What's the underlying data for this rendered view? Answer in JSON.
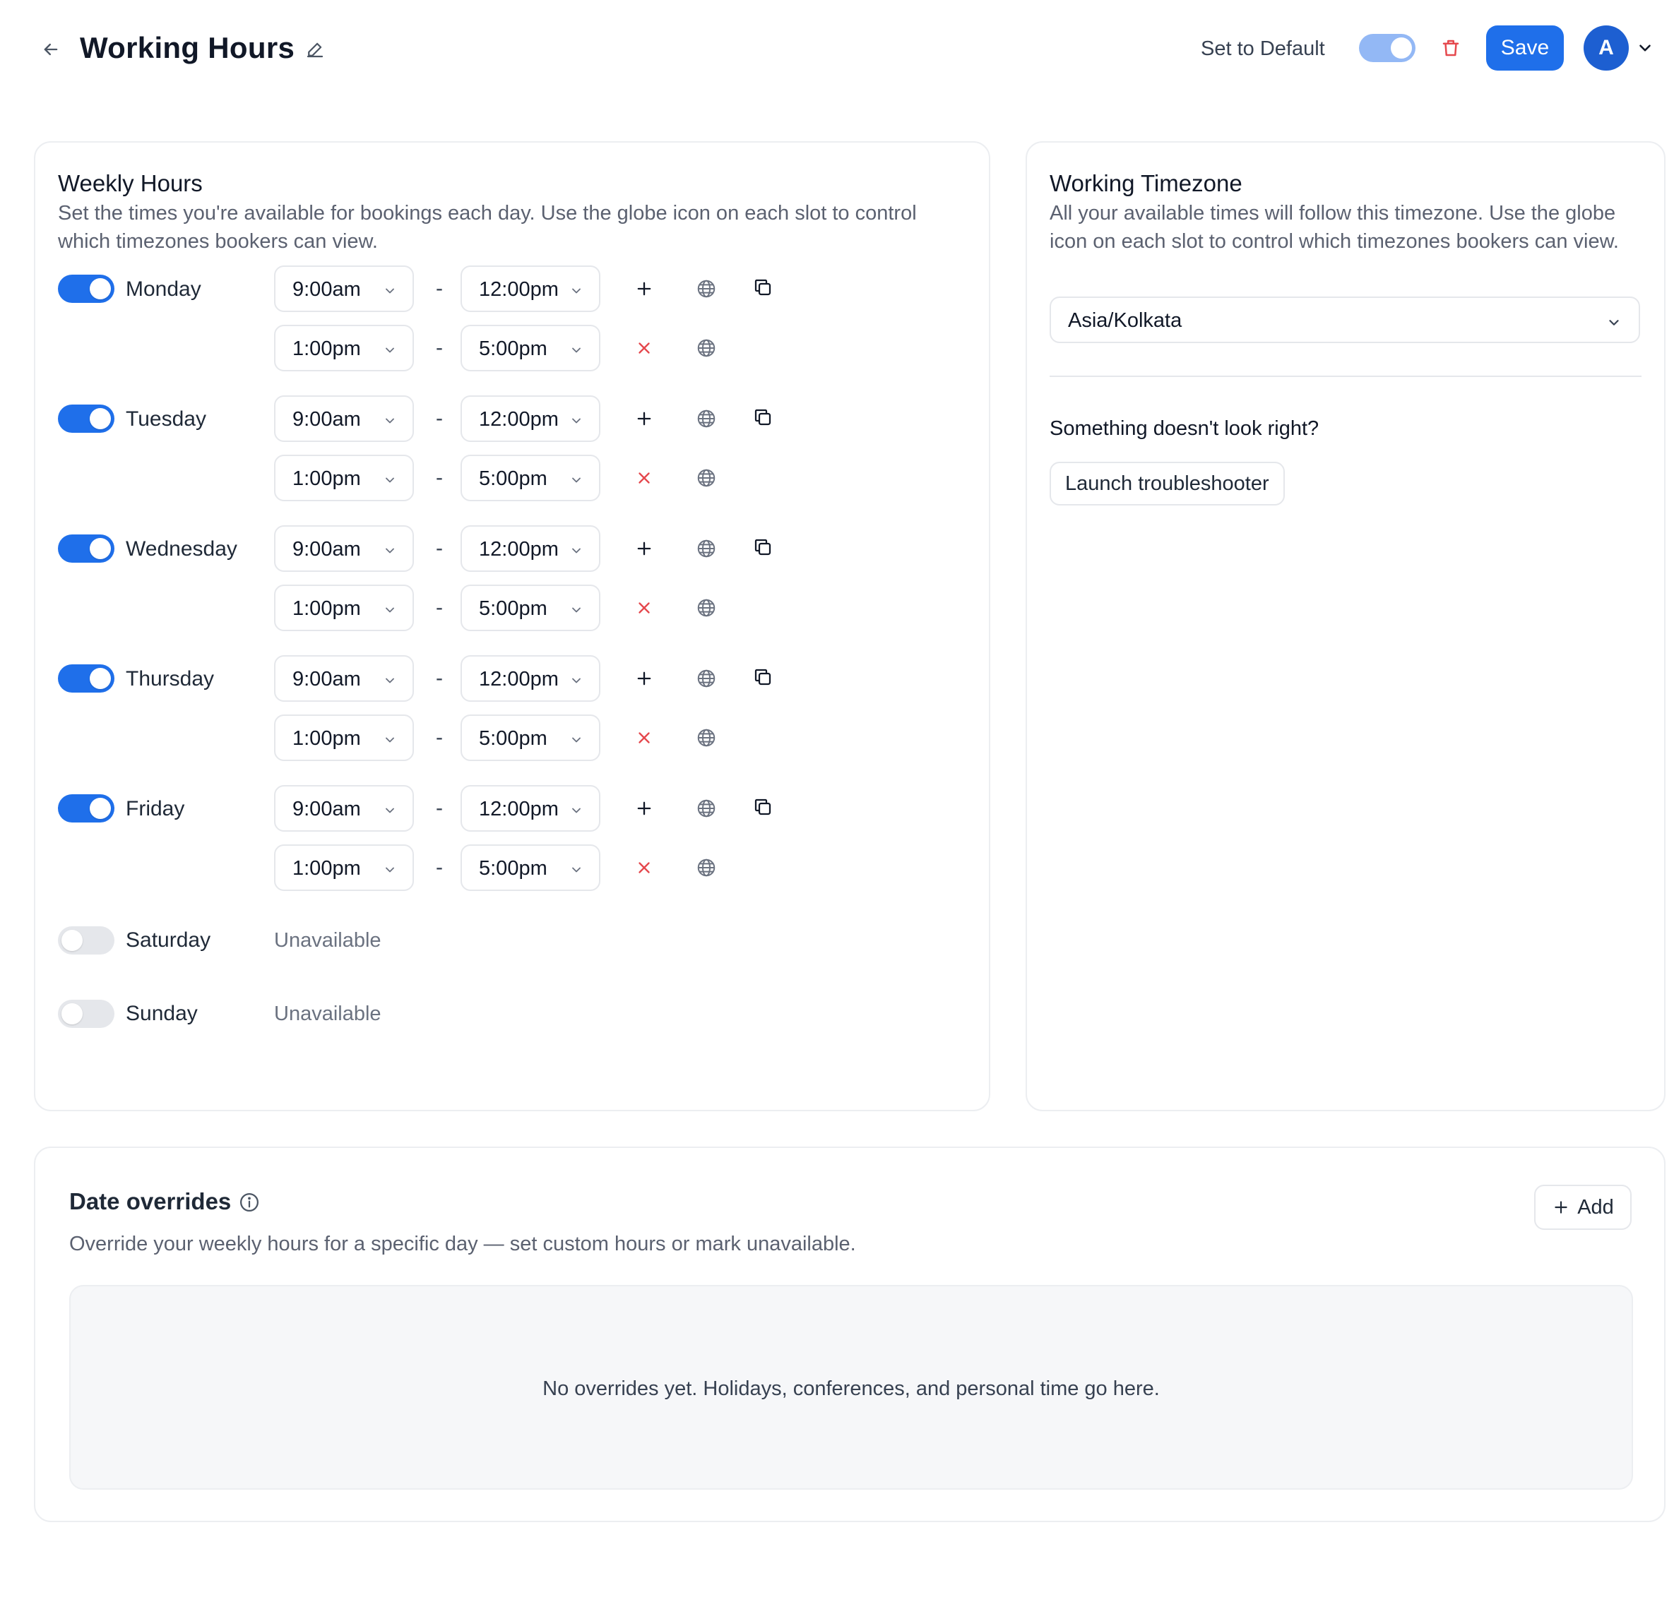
{
  "header": {
    "title": "Working Hours",
    "set_default_label": "Set to Default",
    "set_default_on": true,
    "save_label": "Save",
    "avatar_initial": "A"
  },
  "weekly": {
    "title": "Weekly Hours",
    "description": "Set the times you're available for bookings each day. Use the globe icon on each slot to control which timezones bookers can view.",
    "days": [
      {
        "name": "Monday",
        "enabled": true,
        "slots": [
          {
            "start": "9:00am",
            "end": "12:00pm"
          },
          {
            "start": "1:00pm",
            "end": "5:00pm"
          }
        ]
      },
      {
        "name": "Tuesday",
        "enabled": true,
        "slots": [
          {
            "start": "9:00am",
            "end": "12:00pm"
          },
          {
            "start": "1:00pm",
            "end": "5:00pm"
          }
        ]
      },
      {
        "name": "Wednesday",
        "enabled": true,
        "slots": [
          {
            "start": "9:00am",
            "end": "12:00pm"
          },
          {
            "start": "1:00pm",
            "end": "5:00pm"
          }
        ]
      },
      {
        "name": "Thursday",
        "enabled": true,
        "slots": [
          {
            "start": "9:00am",
            "end": "12:00pm"
          },
          {
            "start": "1:00pm",
            "end": "5:00pm"
          }
        ]
      },
      {
        "name": "Friday",
        "enabled": true,
        "slots": [
          {
            "start": "9:00am",
            "end": "12:00pm"
          },
          {
            "start": "1:00pm",
            "end": "5:00pm"
          }
        ]
      },
      {
        "name": "Saturday",
        "enabled": false,
        "unavailable_label": "Unavailable"
      },
      {
        "name": "Sunday",
        "enabled": false,
        "unavailable_label": "Unavailable"
      }
    ],
    "separator": "-"
  },
  "timezone": {
    "title": "Working Timezone",
    "description": "All your available times will follow this timezone. Use the globe icon on each slot to control which timezones bookers can view.",
    "selected": "Asia/Kolkata",
    "question": "Something doesn't look right?",
    "troubleshooter_label": "Launch troubleshooter"
  },
  "overrides": {
    "title": "Date overrides",
    "description": "Override your weekly hours for a specific day — set custom hours or mark unavailable.",
    "add_label": "Add",
    "empty_text": "No overrides yet. Holidays, conferences, and personal time go here."
  },
  "colors": {
    "accent": "#1f6fea",
    "danger": "#e5484d",
    "toggle_off": "#e5e7eb",
    "default_toggle": "#93b8f5"
  },
  "icons": [
    "arrow-left-icon",
    "pencil-icon",
    "trash-icon",
    "chevron-down-icon",
    "plus-icon",
    "close-icon",
    "globe-icon",
    "copy-icon",
    "info-icon"
  ]
}
